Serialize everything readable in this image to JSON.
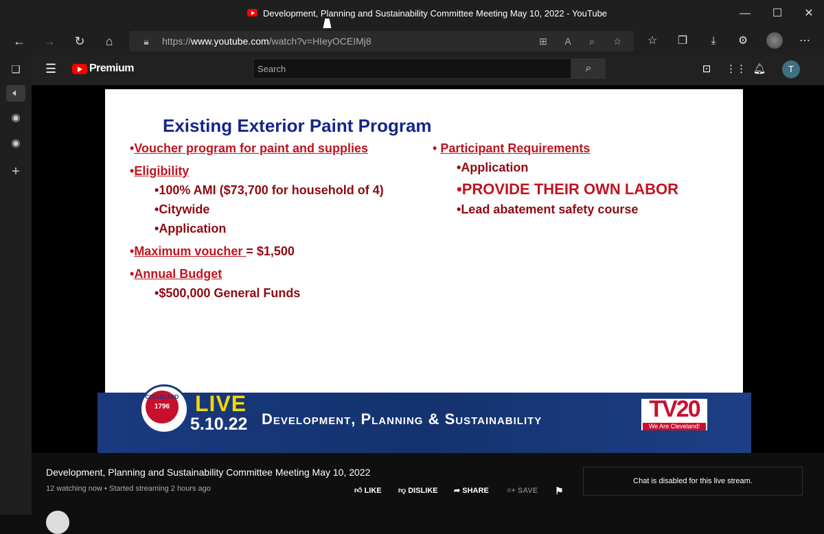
{
  "browser": {
    "window_title": "Development, Planning and Sustainability Committee Meeting May 10, 2022 - YouTube",
    "url_prefix": "https://",
    "url_host": "www.youtube.com",
    "url_path": "/watch?v=HIeyOCEIMj8",
    "profile_initial": ""
  },
  "youtube": {
    "brand": "Premium",
    "search_placeholder": "Search",
    "user_initial": "T"
  },
  "slide": {
    "title": "Existing Exterior Paint Program",
    "left": [
      {
        "bullet": "•",
        "label": "Voucher program for paint and supplies",
        "rest": ""
      },
      {
        "bullet": "•",
        "label": "Eligibility",
        "rest": ""
      },
      {
        "bullet": "•",
        "label": "",
        "rest": "100% AMI ($73,700 for household of 4)"
      },
      {
        "bullet": "•",
        "label": "",
        "rest": "Citywide"
      },
      {
        "bullet": "•",
        "label": "",
        "rest": "Application"
      },
      {
        "bullet": "•",
        "label": "Maximum voucher ",
        "rest": "= $1,500"
      },
      {
        "bullet": "•",
        "label": "Annual Budget",
        "rest": ""
      },
      {
        "bullet": "•",
        "label": "",
        "rest": "$500,000 General Funds"
      }
    ],
    "right": [
      {
        "bullet": "• ",
        "label": "Participant Requirements",
        "rest": ""
      },
      {
        "bullet": "•",
        "label": "",
        "rest": "Application"
      },
      {
        "bullet": "•",
        "label": "",
        "rest": "PROVIDE THEIR OWN LABOR"
      },
      {
        "bullet": "•",
        "label": "",
        "rest": "Lead abatement safety course"
      }
    ]
  },
  "broadcast": {
    "seal_top": "CLEVELAND",
    "seal_year": "1796",
    "live": "LIVE",
    "date": "5.10.22",
    "committee": "Development, Planning & Sustainability",
    "station": "TV20",
    "station_tagline": "We Are Cleveland!"
  },
  "video": {
    "title": "Development, Planning and Sustainability Committee Meeting May 10, 2022",
    "meta": "12 watching now • Started streaming 2 hours ago",
    "actions": {
      "like": "LIKE",
      "dislike": "DISLIKE",
      "share": "SHARE",
      "save": "SAVE"
    },
    "chat_disabled": "Chat is disabled for this live stream."
  }
}
